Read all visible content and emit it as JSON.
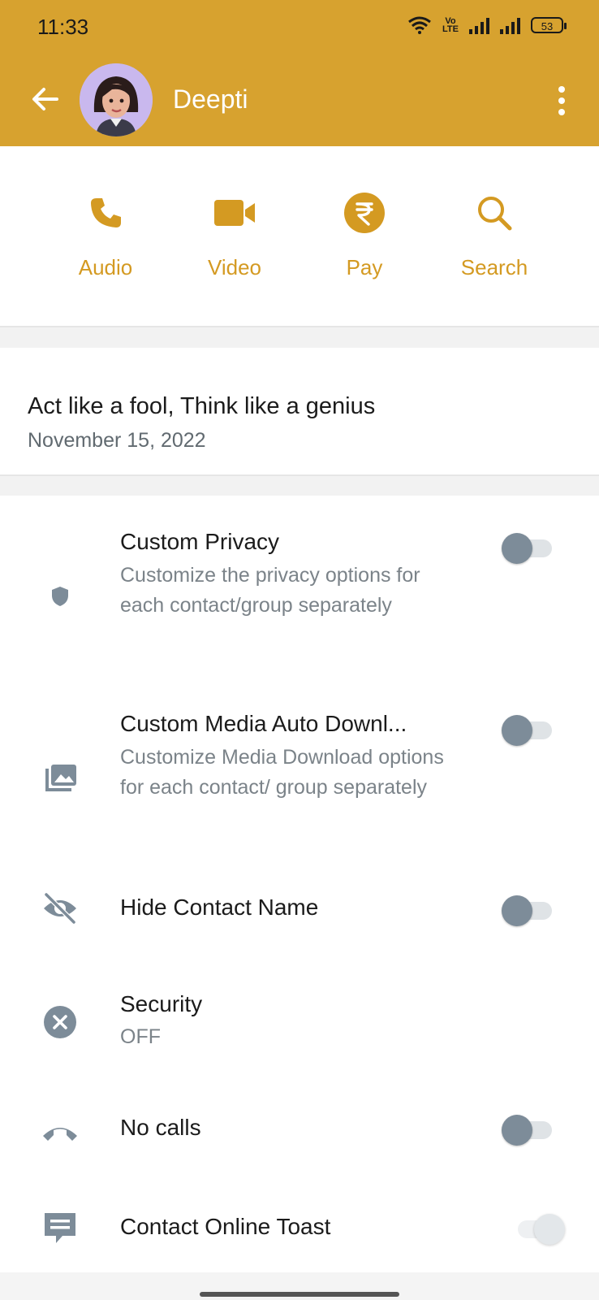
{
  "status_bar": {
    "time": "11:33",
    "network_label": "Vo LTE",
    "battery": "53"
  },
  "header": {
    "contact_name": "Deepti",
    "accent_color": "#D7A22F"
  },
  "actions": [
    {
      "label": "Audio",
      "icon": "phone-icon"
    },
    {
      "label": "Video",
      "icon": "video-camera-icon"
    },
    {
      "label": "Pay",
      "icon": "rupee-icon"
    },
    {
      "label": "Search",
      "icon": "search-icon"
    }
  ],
  "about": {
    "text": "Act like a fool, Think like a genius",
    "date": "November 15, 2022"
  },
  "settings": [
    {
      "title": "Custom Privacy",
      "subtitle": "Customize the privacy options for each contact/group separately",
      "icon": "shield-icon",
      "toggle": "off"
    },
    {
      "title": "Custom Media Auto Downl...",
      "subtitle": "Customize Media Download options for each contact/ group separately",
      "icon": "media-library-icon",
      "toggle": "off"
    },
    {
      "title": "Hide Contact Name",
      "icon": "eye-off-icon",
      "toggle": "off"
    },
    {
      "title": "Security",
      "subtitle": "OFF",
      "icon": "close-circle-icon"
    },
    {
      "title": "No calls",
      "icon": "call-end-icon",
      "toggle": "off"
    },
    {
      "title": "Contact Online Toast",
      "icon": "message-icon",
      "toggle": "disabled"
    }
  ]
}
